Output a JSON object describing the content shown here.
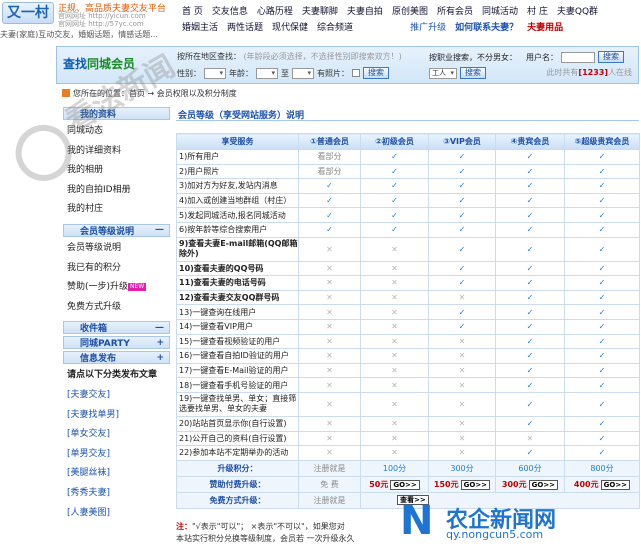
{
  "header": {
    "logo": "又一村",
    "slogan": "正规、高品质夫妻交友平台",
    "urls": [
      "官网网址 http://yicun.com",
      "官网网址 http://57yc.com"
    ],
    "tagline": "夫妻(家庭)互动交友，婚姻话题，情感话题..."
  },
  "nav": {
    "row1": [
      "首  页",
      "交友信息",
      "心路历程",
      "夫妻聊脚",
      "夫妻自拍",
      "原创美图",
      "所有会员",
      "同城活动",
      "村  庄",
      "夫妻QQ群"
    ],
    "row2": [
      "婚姻主活",
      "两性话题",
      "现代保健",
      "综合频道"
    ],
    "promo": "推广升级",
    "contact": "如何联系夫妻？",
    "favorite": "夫妻用品"
  },
  "search": {
    "title_a": "查找",
    "title_b": "同城会员",
    "region_label": "按所在地区查找：",
    "region_hint": "(年龄段必须选择，不选择性别即搜索双方！)",
    "gender_label": "性别：",
    "age_label": "年龄：",
    "to_label": "至",
    "photo_label": "有照片：",
    "search_btn": "搜索",
    "name_label": "按职业搜索，不分男女：",
    "username_label": "用户名：",
    "occupation_value": "工人",
    "online_prefix": "此时共有",
    "online_count": "[1233]",
    "online_suffix": "人在线"
  },
  "breadcrumb": "您所在的位置：首页 → 会员权限以及积分制度",
  "sidebar": {
    "my_section": "我的资料",
    "my_items": [
      "同城动态",
      "我的详细资料",
      "我的相册",
      "我的自拍ID相册",
      "我的村庄"
    ],
    "level_section": "会员等级说明",
    "level_items": [
      "会员等级说明",
      "我已有的积分",
      "赞助(一步)升级",
      "免费方式升级"
    ],
    "new_badge": "NEW",
    "inbox": "收件箱",
    "party": "同城PARTY",
    "publish": "信息发布",
    "publish_title": "请点以下分类发布文章",
    "tags": [
      "[夫妻交友]",
      "[夫妻找单男]",
      "[单女交友]",
      "[单男交友]",
      "[美腿丝袜]",
      "[秀秀夫妻]",
      "[人妻美图]"
    ]
  },
  "section_title": "会员等级（享受网站服务）说明",
  "table": {
    "headers": [
      "享受服务",
      "①普通会员",
      "②初级会员",
      "③VIP会员",
      "④贵宾会员",
      "⑤超级贵宾会员"
    ],
    "rows": [
      {
        "svc": "1)所有用户",
        "b": false,
        "v": [
          "看部分",
          "y",
          "y",
          "y",
          "y"
        ]
      },
      {
        "svc": "2)用户照片",
        "b": false,
        "v": [
          "看部分",
          "y",
          "y",
          "y",
          "y"
        ]
      },
      {
        "svc": "3)加对方为好友,发站内消息",
        "b": false,
        "v": [
          "y",
          "y",
          "y",
          "y",
          "y"
        ]
      },
      {
        "svc": "4)加入或创建当地群组（村庄）",
        "b": false,
        "v": [
          "y",
          "y",
          "y",
          "y",
          "y"
        ]
      },
      {
        "svc": "5)发起同城活动,报名同城活动",
        "b": false,
        "v": [
          "y",
          "y",
          "y",
          "y",
          "y"
        ]
      },
      {
        "svc": "6)按年龄等综合搜索用户",
        "b": false,
        "v": [
          "y",
          "y",
          "y",
          "y",
          "y"
        ]
      },
      {
        "svc": "9)查看夫妻E-mail邮箱(QQ邮箱除外)",
        "b": true,
        "tall": true,
        "v": [
          "n",
          "n",
          "y",
          "y",
          "y"
        ]
      },
      {
        "svc": "10)查看夫妻的QQ号码",
        "b": true,
        "v": [
          "n",
          "n",
          "y",
          "y",
          "y"
        ]
      },
      {
        "svc": "11)查看夫妻的电话号码",
        "b": true,
        "v": [
          "n",
          "n",
          "y",
          "y",
          "y"
        ]
      },
      {
        "svc": "12)查看夫妻交友QQ群号码",
        "b": true,
        "v": [
          "n",
          "n",
          "n",
          "y",
          "y"
        ]
      },
      {
        "svc": "13)一键查询在线用户",
        "b": false,
        "v": [
          "n",
          "n",
          "y",
          "y",
          "y"
        ]
      },
      {
        "svc": "14)一键查看VIP用户",
        "b": false,
        "v": [
          "n",
          "n",
          "y",
          "y",
          "y"
        ]
      },
      {
        "svc": "15)一键查看视频验证的用户",
        "b": false,
        "v": [
          "n",
          "n",
          "n",
          "y",
          "y"
        ]
      },
      {
        "svc": "16)一键查看自拍ID验证的用户",
        "b": false,
        "v": [
          "n",
          "n",
          "n",
          "y",
          "y"
        ]
      },
      {
        "svc": "17)一键查看E-Mail验证的用户",
        "b": false,
        "v": [
          "n",
          "n",
          "n",
          "y",
          "y"
        ]
      },
      {
        "svc": "18)一键查看手机号验证的用户",
        "b": false,
        "v": [
          "n",
          "n",
          "n",
          "y",
          "y"
        ]
      },
      {
        "svc": "19)一键查找单男、单女；直接筛选要找单男、单女的夫妻",
        "b": false,
        "tall": true,
        "v": [
          "n",
          "n",
          "n",
          "y",
          "y"
        ]
      },
      {
        "svc": "20)站站首页显示你(自行设置)",
        "b": false,
        "v": [
          "n",
          "n",
          "n",
          "y",
          "y"
        ]
      },
      {
        "svc": "21)公开自己的资料(自行设置)",
        "b": false,
        "v": [
          "n",
          "n",
          "n",
          "n",
          "y"
        ]
      },
      {
        "svc": "22)参加本站不定期举办的活动",
        "b": false,
        "v": [
          "n",
          "n",
          "n",
          "y",
          "y"
        ]
      }
    ],
    "points_label": "升级积分：",
    "points": [
      "注册就是",
      "100分",
      "300分",
      "600分",
      "800分"
    ],
    "sponsor_label": "赞助付费升级：",
    "sponsor": [
      "免  费",
      "50元",
      "150元",
      "300元",
      "400元"
    ],
    "go_label": "GO>>",
    "free_label": "免费方式升级：",
    "free_first": "注册就是",
    "free_btn": "查看>>"
  },
  "note": {
    "line1_a": "注：",
    "line1_b": "\"√表示\"可以\"；  ×表示\"不可以\"，如果您对",
    "line2": "本站实行积分兑换等级制度，会员若   一次升级永久"
  },
  "watermarks": {
    "left": "看法新闻",
    "right_cn": "农企新闻网",
    "right_url": "qy.nongcun5.com"
  }
}
